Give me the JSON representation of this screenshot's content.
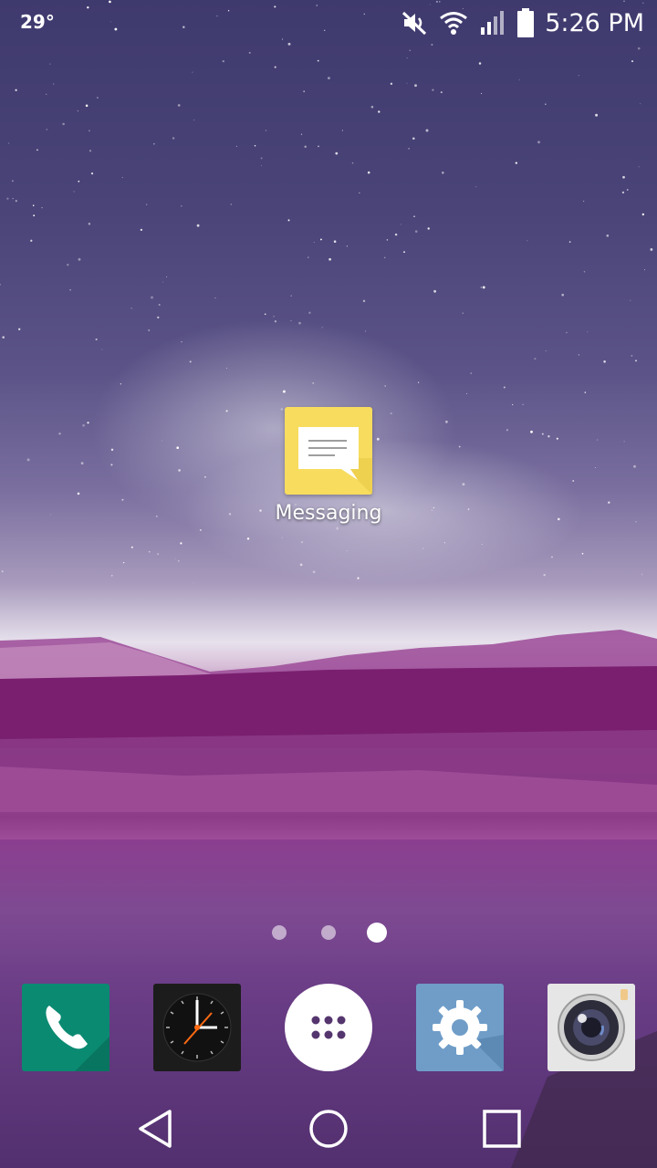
{
  "status_bar": {
    "temperature": "29°",
    "time": "5:26 PM",
    "icons": [
      "mute-icon",
      "wifi-icon",
      "signal-icon",
      "battery-icon"
    ]
  },
  "home": {
    "apps": [
      {
        "label": "Messaging",
        "icon": "messaging-icon",
        "color": "#f7dc5e"
      }
    ],
    "pages": {
      "count": 3,
      "current": 3
    }
  },
  "dock": {
    "items": [
      {
        "name": "phone",
        "icon": "phone-icon",
        "color": "#0b8a72"
      },
      {
        "name": "clock",
        "icon": "clock-icon",
        "color": "#1c1c1c"
      },
      {
        "name": "apps",
        "icon": "app-drawer-icon",
        "color": "#ffffff"
      },
      {
        "name": "settings",
        "icon": "gear-icon",
        "color": "#6f9dc8"
      },
      {
        "name": "camera",
        "icon": "camera-icon",
        "color": "#e6e6e6"
      }
    ]
  },
  "nav_bar": {
    "buttons": [
      "back-icon",
      "home-icon",
      "recents-icon"
    ]
  }
}
